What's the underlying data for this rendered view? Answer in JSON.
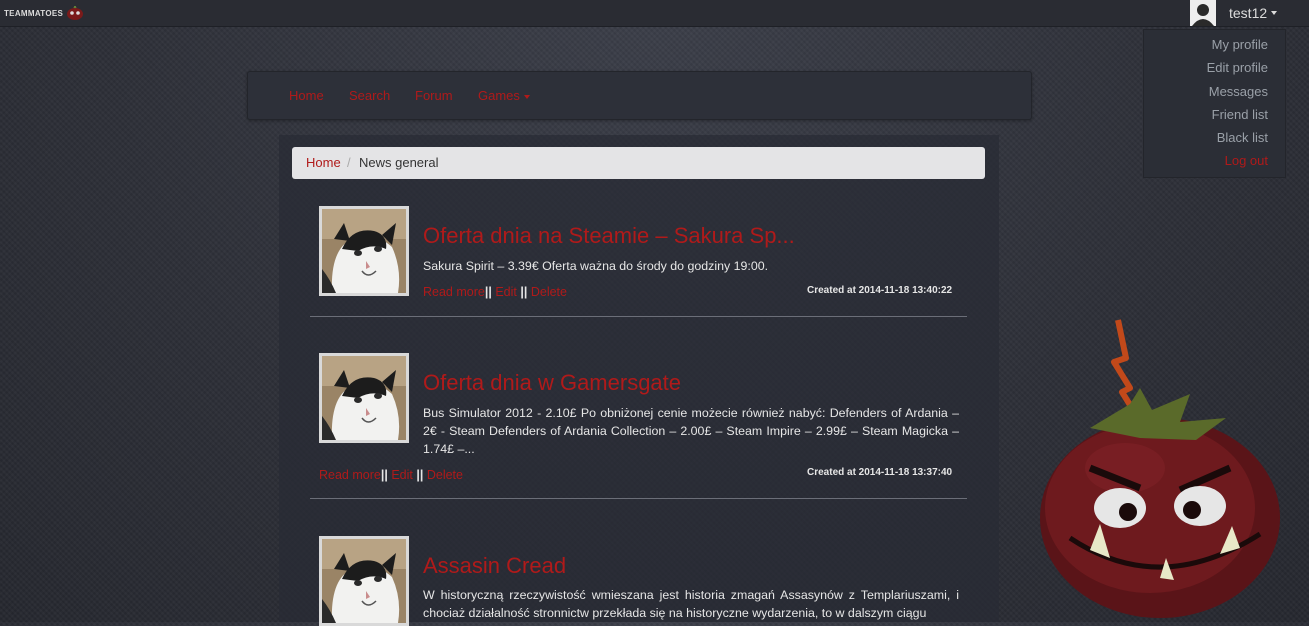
{
  "topbar": {
    "logo_text": "TEAMMATOES",
    "username": "test12"
  },
  "user_menu": {
    "items": [
      "My profile",
      "Edit profile",
      "Messages",
      "Friend list",
      "Black list"
    ],
    "logout": "Log out"
  },
  "nav": {
    "home": "Home",
    "search": "Search",
    "forum": "Forum",
    "games": "Games"
  },
  "breadcrumb": {
    "home": "Home",
    "separator": "/",
    "current": "News general"
  },
  "posts": [
    {
      "title": "Oferta dnia na Steamie – Sakura Sp...",
      "text": "Sakura Spirit – 3.39€ Oferta ważna do środy do godziny 19:00.",
      "read_more": "Read more",
      "edit": "Edit",
      "delete": "Delete",
      "sep": "||",
      "date": "Created at 2014-11-18 13:40:22"
    },
    {
      "title": "Oferta dnia w Gamersgate",
      "text": "Bus Simulator 2012 - 2.10£ Po obniżonej cenie możecie również nabyć: Defenders of Ardania – 2€ - Steam Defenders of Ardania Collection – 2.00£ – Steam Impire – 2.99£ – Steam Magicka – 1.74£ –...",
      "read_more": "Read more",
      "edit": "Edit",
      "delete": "Delete",
      "sep": "||",
      "date": "Created at 2014-11-18 13:37:40"
    },
    {
      "title": "Assasin Cread",
      "text": "W historyczną rzeczywistość wmieszana jest historia zmagań Assasynów z Templariuszami, i chociaż działalność stronnictw przekłada się na historyczne wydarzenia, to w dalszym ciągu"
    }
  ],
  "colors": {
    "accent": "#b01a1a",
    "background": "#2e3038",
    "breadcrumb_bg": "#e4e4e6"
  }
}
